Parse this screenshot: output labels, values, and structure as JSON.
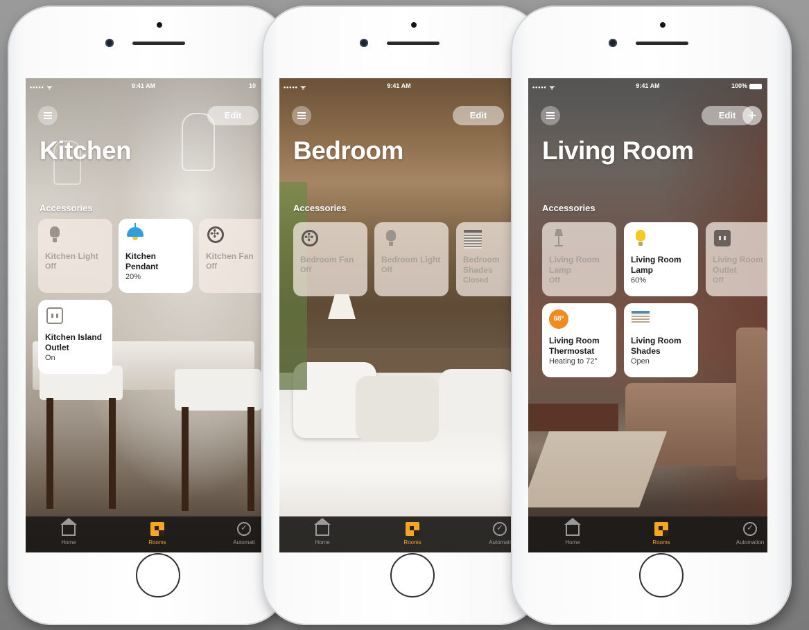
{
  "status": {
    "signal": "••••• ᯤ",
    "time": "9:41 AM",
    "battery_partial": "10",
    "battery_full": "100%"
  },
  "controls": {
    "edit_label": "Edit",
    "add_label": "+"
  },
  "tabs": {
    "home": "Home",
    "rooms": "Rooms",
    "automation": "Automation",
    "automation_truncated": "Automati"
  },
  "section_label": "Accessories",
  "phones": [
    {
      "room": "Kitchen",
      "accessories": [
        {
          "name": "Kitchen Light",
          "state": "Off",
          "icon": "bulb-icon",
          "on": false
        },
        {
          "name": "Kitchen Pendant",
          "state": "20%",
          "icon": "pendant-icon",
          "on": true
        },
        {
          "name": "Kitchen Fan",
          "state": "Off",
          "icon": "fan-icon",
          "on": false
        },
        {
          "name": "Kitchen Island Outlet",
          "state": "On",
          "icon": "outlet-icon",
          "on": true
        }
      ]
    },
    {
      "room": "Bedroom",
      "accessories": [
        {
          "name": "Bedroom Fan",
          "state": "Off",
          "icon": "fan-icon",
          "on": false
        },
        {
          "name": "Bedroom Light",
          "state": "Off",
          "icon": "bulb-icon",
          "on": false
        },
        {
          "name": "Bedroom Shades",
          "state": "Closed",
          "icon": "shades-icon",
          "on": false
        }
      ]
    },
    {
      "room": "Living Room",
      "accessories": [
        {
          "name": "Living Room Lamp",
          "state": "Off",
          "icon": "floor-lamp-icon",
          "on": false
        },
        {
          "name": "Living Room Lamp",
          "state": "60%",
          "icon": "bulb-icon",
          "on": true
        },
        {
          "name": "Living Room Outlet",
          "state": "Off",
          "icon": "outlet-icon",
          "on": false
        },
        {
          "name": "Living Room Thermostat",
          "state": "Heating to 72°",
          "icon": "thermostat-icon",
          "on": true,
          "badge": "68°"
        },
        {
          "name": "Living Room Shades",
          "state": "Open",
          "icon": "shades-icon",
          "on": true
        }
      ]
    }
  ],
  "colors": {
    "accent": "#f5a623",
    "pendant_blue": "#2f9ee0",
    "bulb_yellow": "#f6c91a",
    "thermostat_orange": "#f28b1d"
  }
}
